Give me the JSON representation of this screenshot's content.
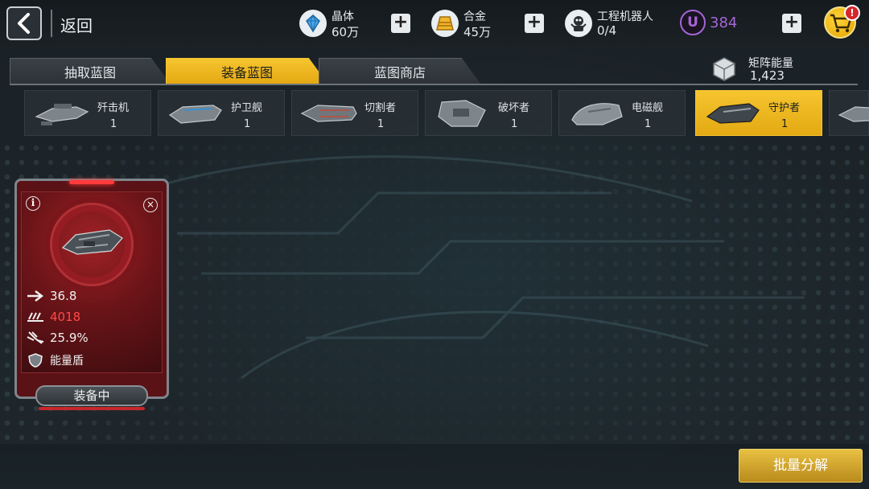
{
  "topbar": {
    "back_label": "返回",
    "resources": [
      {
        "name": "晶体",
        "value": "60万"
      },
      {
        "name": "合金",
        "value": "45万"
      },
      {
        "name": "工程机器人",
        "value": "0/4"
      }
    ],
    "premium_value": "384",
    "premium_color": "#a566d6",
    "cart_badge": "!"
  },
  "tabs": [
    {
      "label": "抽取蓝图",
      "active": false
    },
    {
      "label": "装备蓝图",
      "active": true
    },
    {
      "label": "蓝图商店",
      "active": false
    }
  ],
  "matrix": {
    "label": "矩阵能量",
    "value": "1,423"
  },
  "ships": [
    {
      "name": "歼击机",
      "count": "1",
      "active": false
    },
    {
      "name": "护卫舰",
      "count": "1",
      "active": false
    },
    {
      "name": "切割者",
      "count": "1",
      "active": false
    },
    {
      "name": "破坏者",
      "count": "1",
      "active": false
    },
    {
      "name": "电磁舰",
      "count": "1",
      "active": false
    },
    {
      "name": "守护者",
      "count": "1",
      "active": true
    }
  ],
  "card": {
    "stats": [
      {
        "icon": "speed-arrow-icon",
        "value": "36.8",
        "color": "#f0f0f0"
      },
      {
        "icon": "health-bars-icon",
        "value": "4018",
        "color": "#ff4a4a"
      },
      {
        "icon": "crit-burst-icon",
        "value": "25.9%",
        "color": "#f0f0f0"
      }
    ],
    "skill_label": "能量盾",
    "status_label": "装备中"
  },
  "footer": {
    "batch_label": "批量分解"
  },
  "colors": {
    "accent_yellow": "#f5c530",
    "card_red": "#6b1418"
  }
}
